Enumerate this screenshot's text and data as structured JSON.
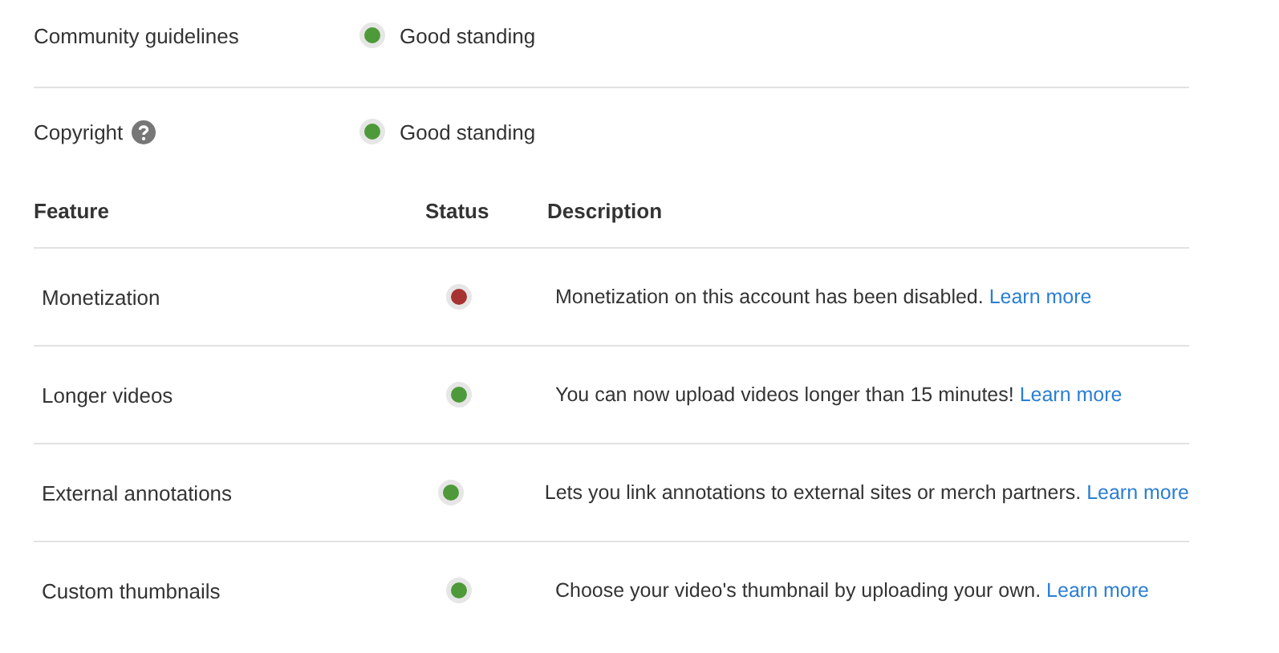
{
  "standing": [
    {
      "label": "Community guidelines",
      "help": false,
      "color": "#4e9a3a",
      "text": "Good standing"
    },
    {
      "label": "Copyright",
      "help": true,
      "color": "#4e9a3a",
      "text": "Good standing"
    }
  ],
  "table": {
    "columns": [
      "Feature",
      "Status",
      "Description"
    ],
    "rows": [
      {
        "feature": "Monetization",
        "color": "#a83232",
        "description": "Monetization on this account has been disabled.",
        "link": "Learn more"
      },
      {
        "feature": "Longer videos",
        "color": "#4e9a3a",
        "description": "You can now upload videos longer than 15 minutes!",
        "link": "Learn more"
      },
      {
        "feature": "External annotations",
        "color": "#4e9a3a",
        "description": "Lets you link annotations to external sites or merch partners.",
        "link": "Learn more"
      },
      {
        "feature": "Custom thumbnails",
        "color": "#4e9a3a",
        "description": "Choose your video's thumbnail by uploading your own.",
        "link": "Learn more"
      }
    ]
  }
}
